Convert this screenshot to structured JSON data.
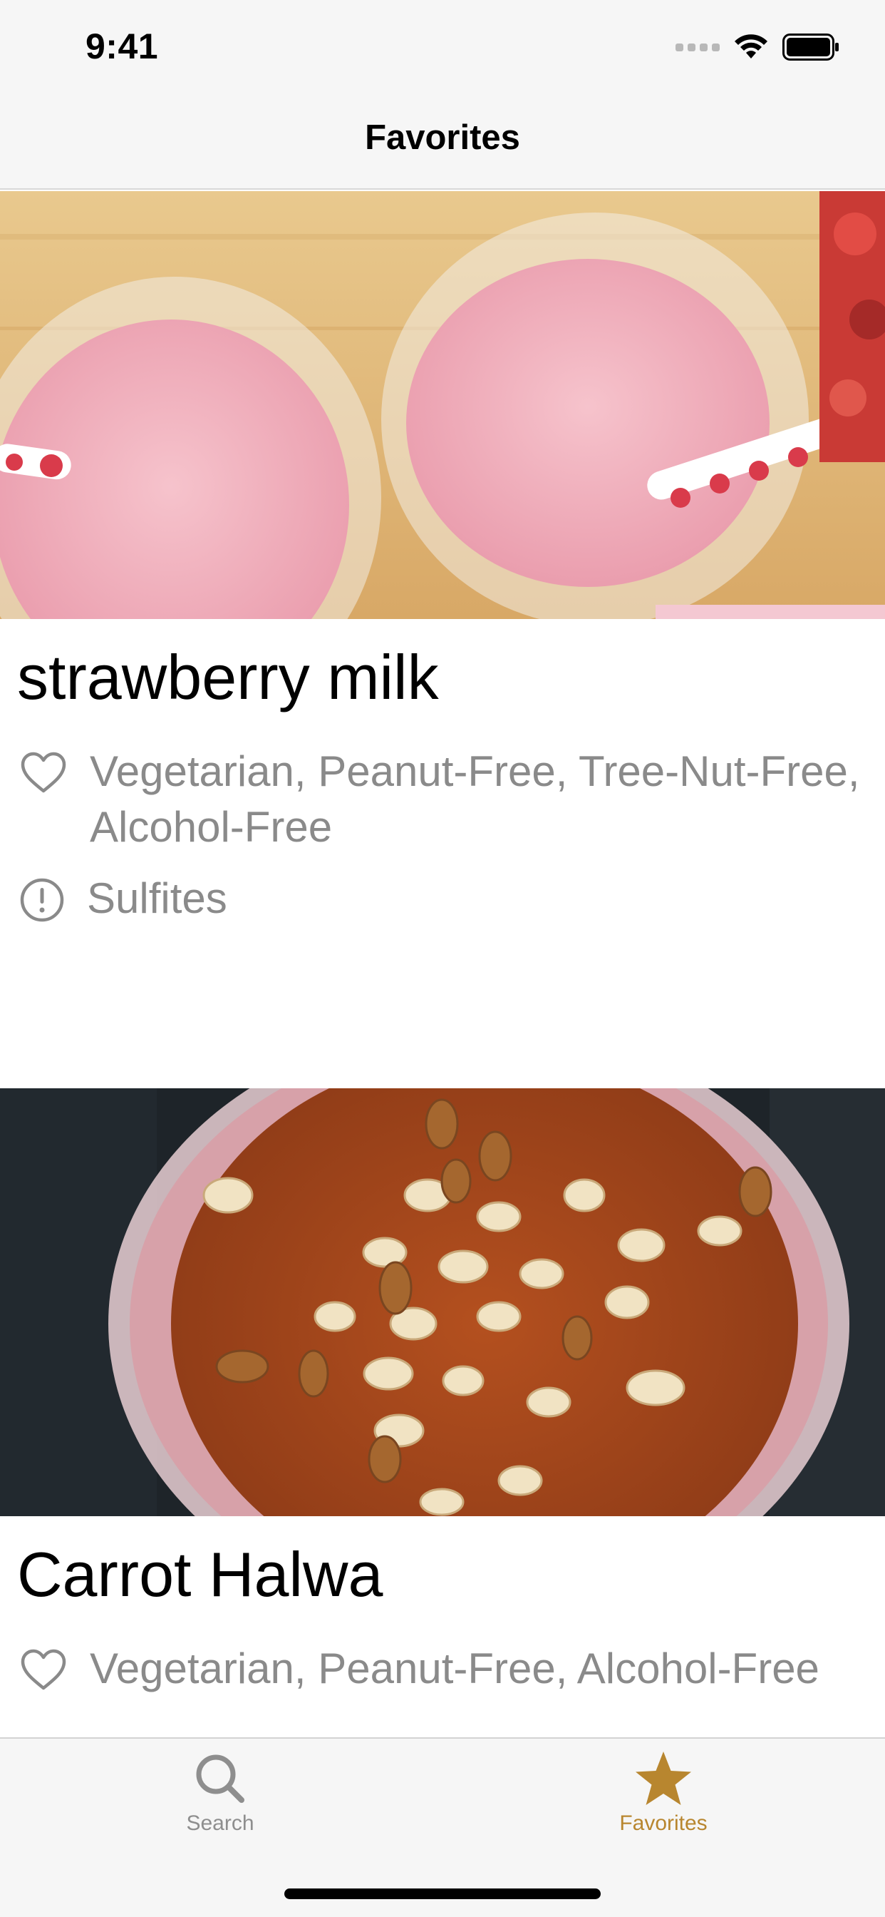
{
  "status_bar": {
    "time": "9:41"
  },
  "nav": {
    "title": "Favorites"
  },
  "recipes": [
    {
      "title": "strawberry milk",
      "health_labels": "Vegetarian, Peanut-Free, Tree-Nut-Free, Alcohol-Free",
      "cautions": "Sulfites",
      "health_icon": "heart-icon",
      "caution_icon": "exclamation-circle-icon"
    },
    {
      "title": "Carrot Halwa",
      "health_labels": "Vegetarian, Peanut-Free, Alcohol-Free",
      "health_icon": "heart-icon"
    }
  ],
  "tab_bar": {
    "items": [
      {
        "label": "Search",
        "icon": "search-icon",
        "selected": false
      },
      {
        "label": "Favorites",
        "icon": "star-icon",
        "selected": true
      }
    ],
    "accent_color": "#b8862f",
    "inactive_color": "#8e8e8e"
  }
}
